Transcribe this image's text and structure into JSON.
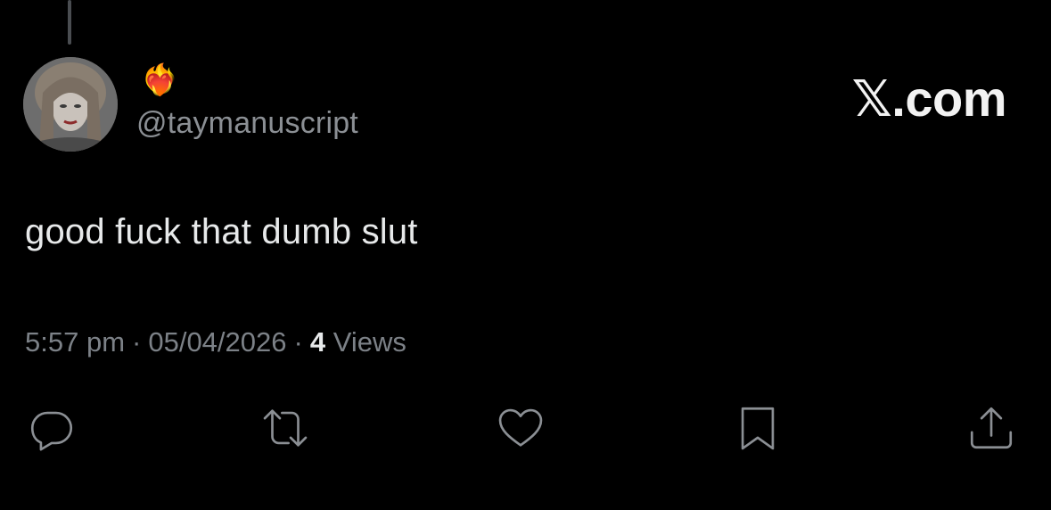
{
  "author": {
    "display_name": "❤️‍🔥",
    "handle": "@taymanuscript"
  },
  "brand": "𝕏.com",
  "tweet": {
    "text": "good fuck that dumb slut",
    "time": "5:57 pm",
    "date": "05/04/2026",
    "separator": "·",
    "views_count": "4",
    "views_label": "Views"
  },
  "actions": {
    "reply_icon": "reply-icon",
    "repost_icon": "repost-icon",
    "like_icon": "heart-icon",
    "bookmark_icon": "bookmark-icon",
    "share_icon": "share-icon"
  },
  "colors": {
    "background": "#000000",
    "primary_text": "#e7e9ea",
    "secondary_text": "#8b8f94"
  }
}
